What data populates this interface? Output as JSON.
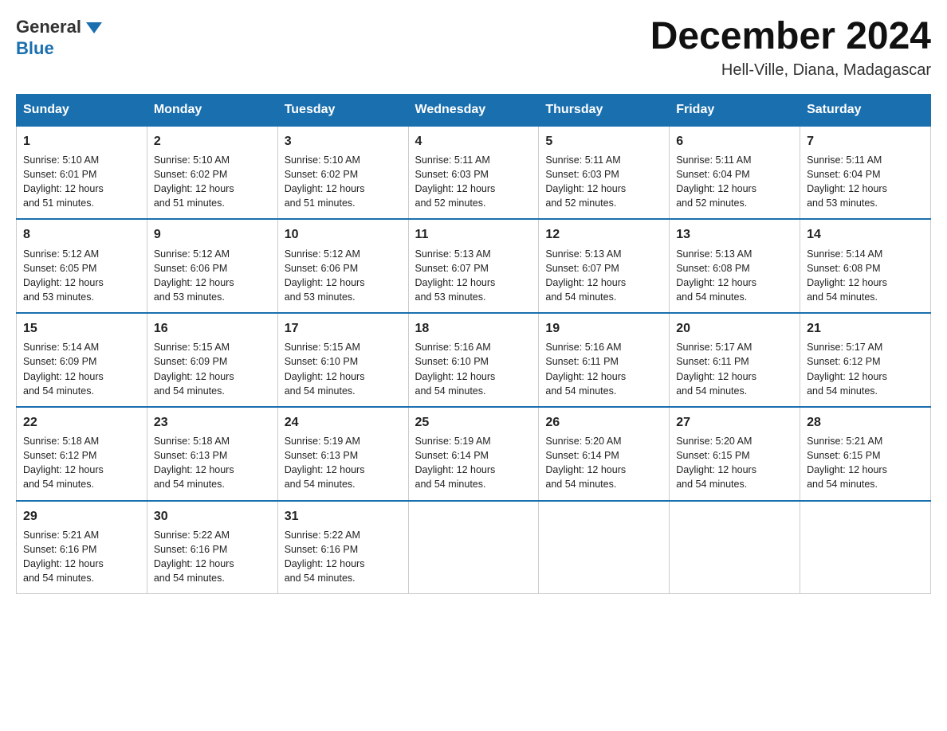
{
  "header": {
    "logo_general": "General",
    "logo_blue": "Blue",
    "title": "December 2024",
    "subtitle": "Hell-Ville, Diana, Madagascar"
  },
  "days_of_week": [
    "Sunday",
    "Monday",
    "Tuesday",
    "Wednesday",
    "Thursday",
    "Friday",
    "Saturday"
  ],
  "weeks": [
    [
      {
        "day": "1",
        "sunrise": "5:10 AM",
        "sunset": "6:01 PM",
        "daylight": "12 hours and 51 minutes."
      },
      {
        "day": "2",
        "sunrise": "5:10 AM",
        "sunset": "6:02 PM",
        "daylight": "12 hours and 51 minutes."
      },
      {
        "day": "3",
        "sunrise": "5:10 AM",
        "sunset": "6:02 PM",
        "daylight": "12 hours and 51 minutes."
      },
      {
        "day": "4",
        "sunrise": "5:11 AM",
        "sunset": "6:03 PM",
        "daylight": "12 hours and 52 minutes."
      },
      {
        "day": "5",
        "sunrise": "5:11 AM",
        "sunset": "6:03 PM",
        "daylight": "12 hours and 52 minutes."
      },
      {
        "day": "6",
        "sunrise": "5:11 AM",
        "sunset": "6:04 PM",
        "daylight": "12 hours and 52 minutes."
      },
      {
        "day": "7",
        "sunrise": "5:11 AM",
        "sunset": "6:04 PM",
        "daylight": "12 hours and 53 minutes."
      }
    ],
    [
      {
        "day": "8",
        "sunrise": "5:12 AM",
        "sunset": "6:05 PM",
        "daylight": "12 hours and 53 minutes."
      },
      {
        "day": "9",
        "sunrise": "5:12 AM",
        "sunset": "6:06 PM",
        "daylight": "12 hours and 53 minutes."
      },
      {
        "day": "10",
        "sunrise": "5:12 AM",
        "sunset": "6:06 PM",
        "daylight": "12 hours and 53 minutes."
      },
      {
        "day": "11",
        "sunrise": "5:13 AM",
        "sunset": "6:07 PM",
        "daylight": "12 hours and 53 minutes."
      },
      {
        "day": "12",
        "sunrise": "5:13 AM",
        "sunset": "6:07 PM",
        "daylight": "12 hours and 54 minutes."
      },
      {
        "day": "13",
        "sunrise": "5:13 AM",
        "sunset": "6:08 PM",
        "daylight": "12 hours and 54 minutes."
      },
      {
        "day": "14",
        "sunrise": "5:14 AM",
        "sunset": "6:08 PM",
        "daylight": "12 hours and 54 minutes."
      }
    ],
    [
      {
        "day": "15",
        "sunrise": "5:14 AM",
        "sunset": "6:09 PM",
        "daylight": "12 hours and 54 minutes."
      },
      {
        "day": "16",
        "sunrise": "5:15 AM",
        "sunset": "6:09 PM",
        "daylight": "12 hours and 54 minutes."
      },
      {
        "day": "17",
        "sunrise": "5:15 AM",
        "sunset": "6:10 PM",
        "daylight": "12 hours and 54 minutes."
      },
      {
        "day": "18",
        "sunrise": "5:16 AM",
        "sunset": "6:10 PM",
        "daylight": "12 hours and 54 minutes."
      },
      {
        "day": "19",
        "sunrise": "5:16 AM",
        "sunset": "6:11 PM",
        "daylight": "12 hours and 54 minutes."
      },
      {
        "day": "20",
        "sunrise": "5:17 AM",
        "sunset": "6:11 PM",
        "daylight": "12 hours and 54 minutes."
      },
      {
        "day": "21",
        "sunrise": "5:17 AM",
        "sunset": "6:12 PM",
        "daylight": "12 hours and 54 minutes."
      }
    ],
    [
      {
        "day": "22",
        "sunrise": "5:18 AM",
        "sunset": "6:12 PM",
        "daylight": "12 hours and 54 minutes."
      },
      {
        "day": "23",
        "sunrise": "5:18 AM",
        "sunset": "6:13 PM",
        "daylight": "12 hours and 54 minutes."
      },
      {
        "day": "24",
        "sunrise": "5:19 AM",
        "sunset": "6:13 PM",
        "daylight": "12 hours and 54 minutes."
      },
      {
        "day": "25",
        "sunrise": "5:19 AM",
        "sunset": "6:14 PM",
        "daylight": "12 hours and 54 minutes."
      },
      {
        "day": "26",
        "sunrise": "5:20 AM",
        "sunset": "6:14 PM",
        "daylight": "12 hours and 54 minutes."
      },
      {
        "day": "27",
        "sunrise": "5:20 AM",
        "sunset": "6:15 PM",
        "daylight": "12 hours and 54 minutes."
      },
      {
        "day": "28",
        "sunrise": "5:21 AM",
        "sunset": "6:15 PM",
        "daylight": "12 hours and 54 minutes."
      }
    ],
    [
      {
        "day": "29",
        "sunrise": "5:21 AM",
        "sunset": "6:16 PM",
        "daylight": "12 hours and 54 minutes."
      },
      {
        "day": "30",
        "sunrise": "5:22 AM",
        "sunset": "6:16 PM",
        "daylight": "12 hours and 54 minutes."
      },
      {
        "day": "31",
        "sunrise": "5:22 AM",
        "sunset": "6:16 PM",
        "daylight": "12 hours and 54 minutes."
      },
      null,
      null,
      null,
      null
    ]
  ],
  "labels": {
    "sunrise": "Sunrise:",
    "sunset": "Sunset:",
    "daylight": "Daylight:"
  }
}
